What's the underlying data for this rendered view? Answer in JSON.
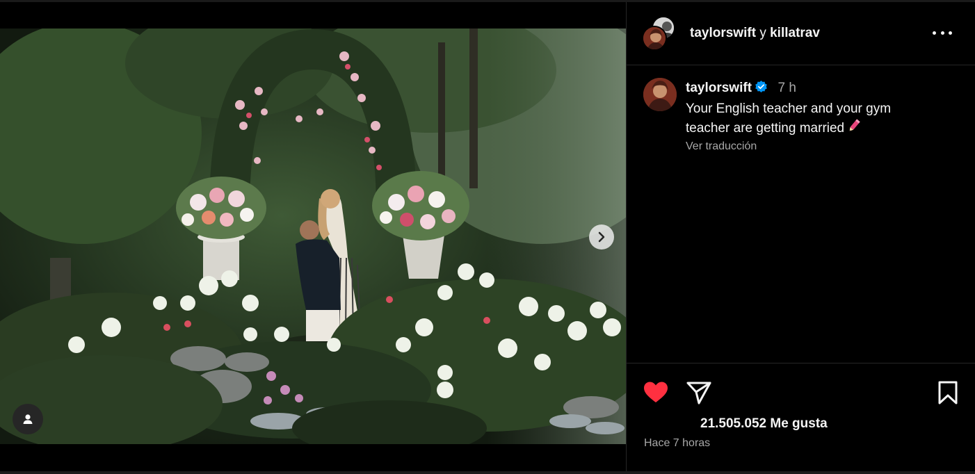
{
  "header": {
    "user1": "taylorswift",
    "conjunction": "y",
    "user2": "killatrav"
  },
  "caption": {
    "username": "taylorswift",
    "time": "7 h",
    "text": "Your English teacher and your gym teacher are getting married",
    "translate_link": "Ver traducción"
  },
  "actions": {
    "like_color": "#ff3040",
    "likes_text": "21.505.052 Me gusta",
    "time_ago": "Hace 7 horas"
  },
  "colors": {
    "verified": "#0095f6",
    "background": "#000000",
    "secondary_text": "#a8a8a8"
  },
  "icons": [
    "more-icon",
    "verified-icon",
    "heart-icon",
    "share-icon",
    "bookmark-icon",
    "chevron-right-icon",
    "user-tag-icon",
    "pencil-emoji-icon"
  ]
}
